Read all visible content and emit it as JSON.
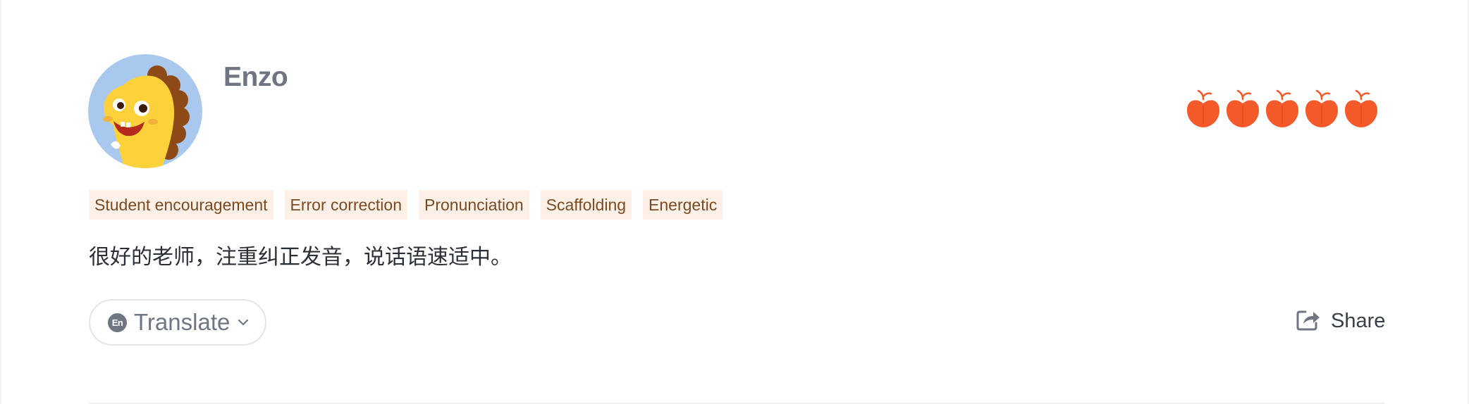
{
  "review": {
    "reviewer_name": "Enzo",
    "rating": 5,
    "rating_icon": "apple-icon",
    "tags": [
      "Student encouragement",
      "Error correction",
      "Pronunciation",
      "Scaffolding",
      "Energetic"
    ],
    "comment": "很好的老师，注重纠正发音，说话语速适中。"
  },
  "actions": {
    "translate_badge": "En",
    "translate_label": "Translate",
    "share_label": "Share"
  },
  "colors": {
    "rating_apple": "#f4592a",
    "tag_background": "#fdf1e7",
    "tag_text": "#7b4a22",
    "avatar_background": "#a9c8ee",
    "avatar_character": "#fdd13a",
    "avatar_spikes": "#8d4a17"
  }
}
